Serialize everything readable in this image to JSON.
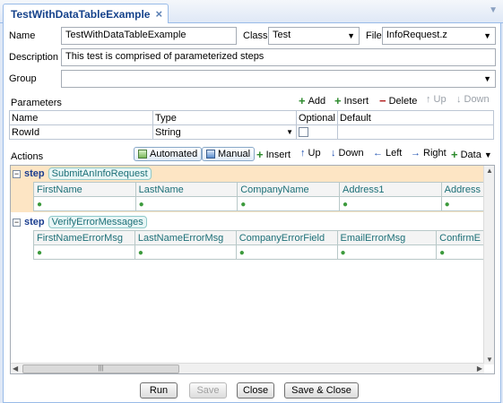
{
  "tab": {
    "title": "TestWithDataTableExample",
    "close": "×"
  },
  "form": {
    "name_label": "Name",
    "name_value": "TestWithDataTableExample",
    "class_label": "Class",
    "class_value": "Test",
    "file_label": "File",
    "file_value": "InfoRequest.z",
    "description_label": "Description",
    "description_value": "This test is comprised of parameterized steps",
    "group_label": "Group",
    "group_value": ""
  },
  "parameters": {
    "title": "Parameters",
    "toolbar": {
      "add": "Add",
      "insert": "Insert",
      "delete": "Delete",
      "up": "Up",
      "down": "Down"
    },
    "columns": [
      "Name",
      "Type",
      "Optional",
      "Default"
    ],
    "rows": [
      {
        "name": "RowId",
        "type": "String",
        "optional": false,
        "default": ""
      }
    ]
  },
  "actions": {
    "title": "Actions",
    "toolbar": {
      "automated": "Automated",
      "manual": "Manual",
      "insert": "Insert",
      "up": "Up",
      "down": "Down",
      "left": "Left",
      "right": "Right",
      "data": "Data"
    },
    "steps": [
      {
        "keyword": "step",
        "name": "SubmitAnInfoRequest",
        "selected": true,
        "columns": [
          "FirstName",
          "LastName",
          "CompanyName",
          "Address1",
          "Address"
        ]
      },
      {
        "keyword": "step",
        "name": "VerifyErrorMessages",
        "selected": false,
        "columns": [
          "FirstNameErrorMsg",
          "LastNameErrorMsg",
          "CompanyErrorField",
          "EmailErrorMsg",
          "ConfirmE"
        ]
      }
    ]
  },
  "buttons": {
    "run": "Run",
    "save": "Save",
    "close": "Close",
    "save_close": "Save & Close"
  },
  "colors": {
    "panel_border": "#99bbe8",
    "selected_step": "#fde5c4",
    "step_label": "#1c6f77"
  }
}
